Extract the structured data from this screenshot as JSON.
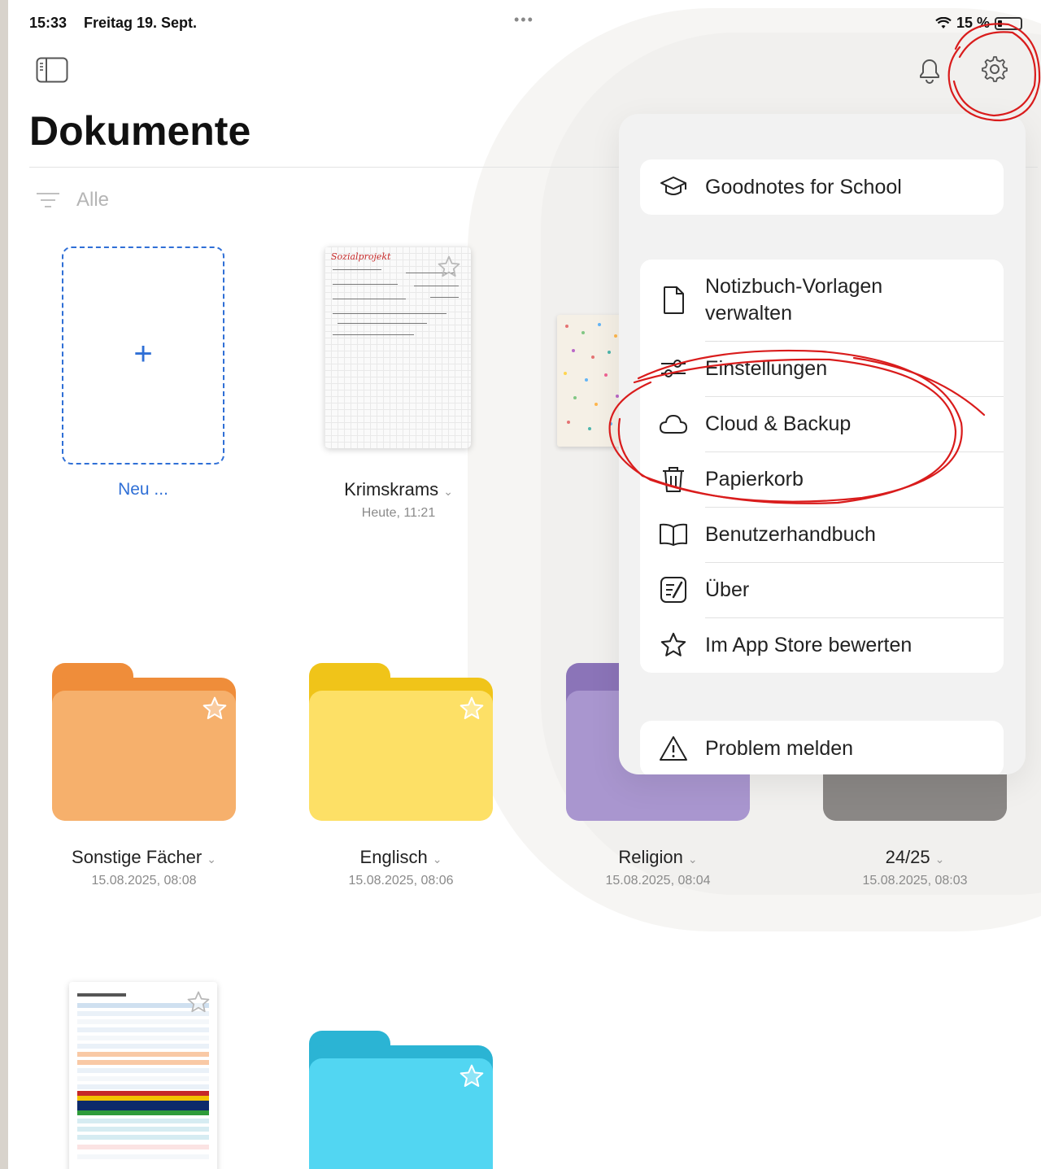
{
  "status": {
    "time": "15:33",
    "date": "Freitag 19. Sept.",
    "dots": "•••",
    "battery": "15 %"
  },
  "header": {
    "title": "Dokumente",
    "filter_label": "Alle"
  },
  "new_item": {
    "plus": "+",
    "label": "Neu ..."
  },
  "documents": [
    {
      "title": "Krimskrams",
      "subtitle": "Heute, 11:21",
      "cover_heading": "Sozialprojekt"
    }
  ],
  "folders": [
    {
      "title": "Sonstige Fächer",
      "subtitle": "15.08.2025, 08:08",
      "color": "#f6b06c",
      "tab_color": "#ef8d3a"
    },
    {
      "title": "Englisch",
      "subtitle": "15.08.2025, 08:06",
      "color": "#fde066",
      "tab_color": "#f0c419"
    },
    {
      "title": "Religion",
      "subtitle": "15.08.2025, 08:04",
      "color": "#a996cf",
      "tab_color": "#8b74b8"
    },
    {
      "title": "24/25",
      "subtitle": "15.08.2025, 08:03",
      "color": "#8a8785",
      "tab_color": "#6f6c6a"
    },
    {
      "title": "",
      "subtitle": "",
      "color": "#52d6f2",
      "tab_color": "#2bb4d4"
    }
  ],
  "menu": {
    "school": "Goodnotes for School",
    "items": [
      {
        "label": "Notizbuch-Vorlagen verwalten",
        "icon": "document-icon"
      },
      {
        "label": "Einstellungen",
        "icon": "sliders-icon"
      },
      {
        "label": "Cloud & Backup",
        "icon": "cloud-icon"
      },
      {
        "label": "Papierkorb",
        "icon": "trash-icon"
      },
      {
        "label": "Benutzerhandbuch",
        "icon": "book-icon"
      },
      {
        "label": "Über",
        "icon": "about-icon"
      },
      {
        "label": "Im App Store bewerten",
        "icon": "star-icon"
      }
    ],
    "report": "Problem melden"
  },
  "colors": {
    "accent": "#2f6fd6",
    "annotation": "#d91c1c"
  }
}
